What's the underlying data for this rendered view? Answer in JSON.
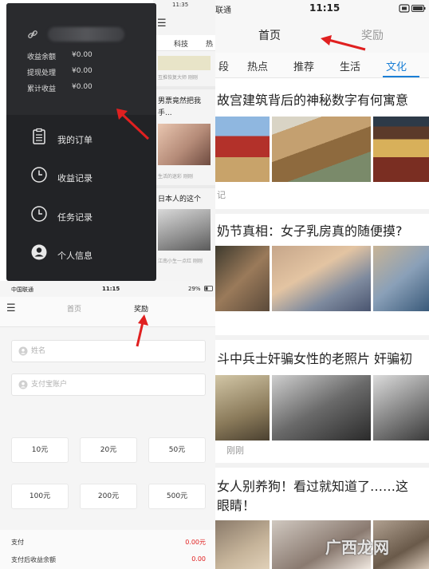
{
  "drawer": {
    "stats": [
      {
        "label": "收益余额",
        "value": "¥0.00"
      },
      {
        "label": "提现处理",
        "value": "¥0.00"
      },
      {
        "label": "累计收益",
        "value": "¥0.00"
      }
    ],
    "menu": [
      {
        "label": "我的订单",
        "icon": "clipboard-icon"
      },
      {
        "label": "收益记录",
        "icon": "clock-icon"
      },
      {
        "label": "任务记录",
        "icon": "clock-icon"
      },
      {
        "label": "个人信息",
        "icon": "person-icon"
      }
    ]
  },
  "strip": {
    "time": "11:35",
    "tabs": [
      "科技",
      "热"
    ],
    "items": [
      {
        "meta": "互推恢复大师 刚刚"
      },
      {
        "title": "男票竟然把我手..."
      },
      {
        "meta": "生活的迷彩 刚刚"
      },
      {
        "title": "日本人的这个"
      },
      {
        "meta": "江南小生一点红 刚刚"
      }
    ]
  },
  "phone": {
    "carrier": "联通",
    "time": "11:15",
    "nav_tabs": [
      "首页",
      "奖励"
    ],
    "categories": [
      "段",
      "热点",
      "推荐",
      "生活",
      "文化"
    ],
    "active_category": "文化",
    "accent": "#1a7fd6",
    "articles": [
      {
        "title": "故宫建筑背后的神秘数字有何寓意",
        "meta": "记"
      },
      {
        "title": "奶节真相：女子乳房真的随便摸?",
        "meta": ""
      },
      {
        "title": "斗中兵士奸骗女性的老照片 奸骗初",
        "meta": "刚刚"
      },
      {
        "title_line1": "女人别养狗！看过就知道了……这",
        "title_line2": "眼睛！"
      }
    ]
  },
  "reward": {
    "carrier": "中国联通",
    "time": "11:15",
    "battery": "29%",
    "nav_tabs": [
      "首页",
      "奖励"
    ],
    "name_placeholder": "姓名",
    "alipay_placeholder": "支付宝账户",
    "amounts": [
      "10元",
      "20元",
      "50元",
      "100元",
      "200元",
      "500元"
    ],
    "pay_label": "支付",
    "pay_value": "0.00元",
    "balance_label": "支付后收益余额",
    "balance_value": "0.00"
  },
  "watermark": "广西龙网"
}
